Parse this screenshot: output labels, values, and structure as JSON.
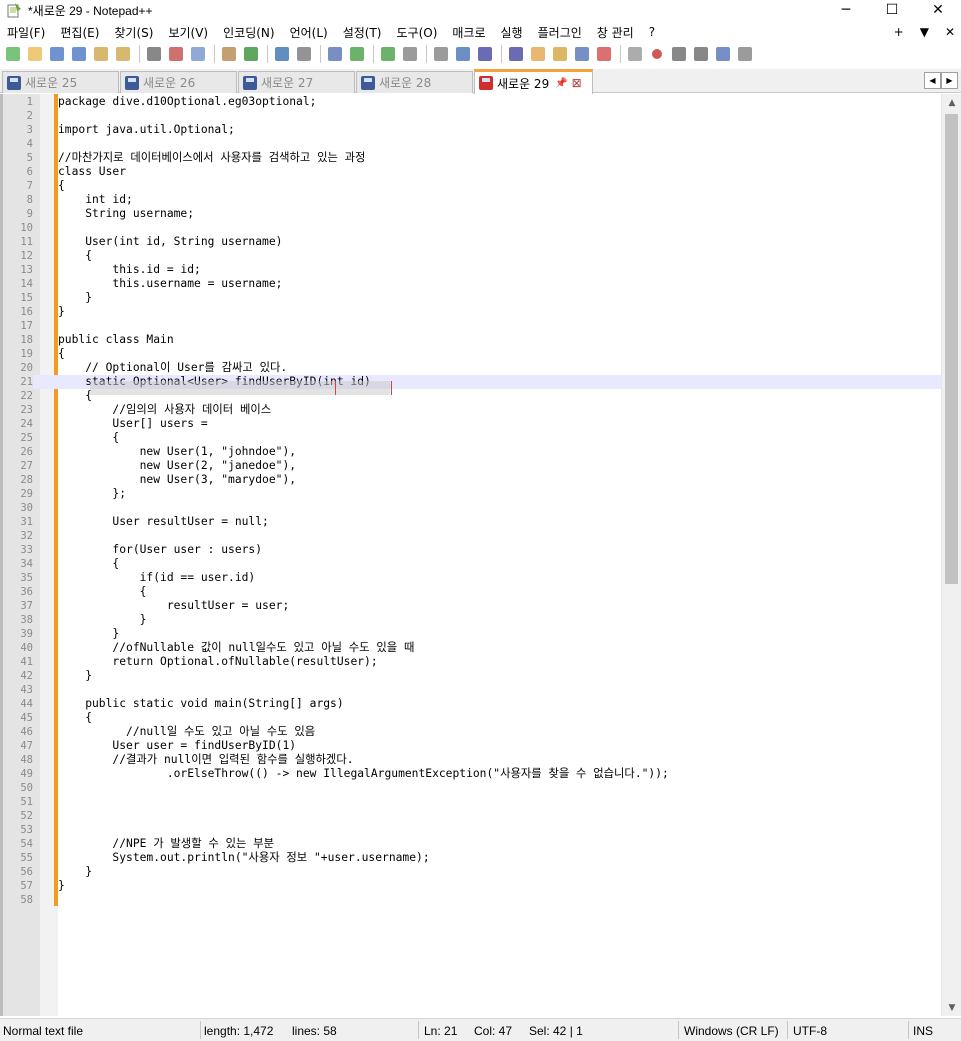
{
  "window": {
    "title": "*새로운 29 - Notepad++",
    "minimize": "─",
    "maximize": "☐",
    "close": "✕"
  },
  "menu": {
    "items": [
      "파일(F)",
      "편집(E)",
      "찾기(S)",
      "보기(V)",
      "인코딩(N)",
      "언어(L)",
      "설정(T)",
      "도구(O)",
      "매크로",
      "실행",
      "플러그인",
      "창 관리",
      "?"
    ],
    "right": [
      "+",
      "▼",
      "✕"
    ]
  },
  "toolbar": {
    "icons": [
      "new-file-icon",
      "open-file-icon",
      "save-icon",
      "save-all-icon",
      "close-icon",
      "close-all-icon",
      "print-icon",
      "cut-icon",
      "copy-icon",
      "paste-icon",
      "undo-icon",
      "redo-icon",
      "find-icon",
      "replace-icon",
      "zoom-in-icon",
      "zoom-out-icon",
      "sync-vertical-icon",
      "sync-horizontal-icon",
      "word-wrap-icon",
      "show-all-chars-icon",
      "indent-guide-icon",
      "udl-icon",
      "doc-map-icon",
      "function-list-icon",
      "folder-workspace-icon",
      "monitoring-icon",
      "record-macro-icon",
      "stop-macro-icon",
      "play-macro-icon",
      "run-macro-multiple-icon",
      "save-macro-icon"
    ]
  },
  "tabs": [
    {
      "label": "새로운 25"
    },
    {
      "label": "새로운 26"
    },
    {
      "label": "새로운 27"
    },
    {
      "label": "새로운 28"
    },
    {
      "label": "새로운 29",
      "pin": "📌",
      "close": "⊠"
    }
  ],
  "tab_nav": {
    "left": "◀",
    "right": "▶"
  },
  "editor": {
    "current_line": 21,
    "lines": [
      "package dive.d10Optional.eg03optional;",
      "",
      "import java.util.Optional;",
      "",
      "//마찬가지로 데이터베이스에서 사용자를 검색하고 있는 과정",
      "class User",
      "{",
      "    int id;",
      "    String username;",
      "",
      "    User(int id, String username)",
      "    {",
      "        this.id = id;",
      "        this.username = username;",
      "    }",
      "}",
      "",
      "public class Main",
      "{",
      "    // Optional이 User를 감싸고 있다.",
      "    static Optional<User> findUserByID(int id)",
      "    {",
      "        //임의의 사용자 데이터 베이스",
      "        User[] users =",
      "        {",
      "            new User(1, \"johndoe\"),",
      "            new User(2, \"janedoe\"),",
      "            new User(3, \"marydoe\"),",
      "        };",
      "",
      "        User resultUser = null;",
      "",
      "        for(User user : users)",
      "        {",
      "            if(id == user.id)",
      "            {",
      "                resultUser = user;",
      "            }",
      "        }",
      "        //ofNullable 값이 null일수도 있고 아닐 수도 있을 때",
      "        return Optional.ofNullable(resultUser);",
      "    }",
      "",
      "    public static void main(String[] args)",
      "    {",
      "          //null일 수도 있고 아닐 수도 있음",
      "        User user = findUserByID(1)",
      "        //결과가 null이면 입력된 함수를 실행하겠다.",
      "                .orElseThrow(() -> new IllegalArgumentException(\"사용자를 찾을 수 없습니다.\"));",
      "",
      "",
      "",
      "",
      "        //NPE 가 발생할 수 있는 부분",
      "        System.out.println(\"사용자 정보 \"+user.username);",
      "    }",
      "}",
      ""
    ]
  },
  "scrollbar": {
    "up": "▲",
    "down": "▼"
  },
  "status": {
    "type": "Normal text file",
    "length": "length: 1,472",
    "lines": "lines: 58",
    "ln": "Ln: 21",
    "col": "Col: 47",
    "sel": "Sel: 42 | 1",
    "eol": "Windows (CR LF)",
    "encoding": "UTF-8",
    "mode": "INS"
  },
  "colors": {
    "accent_tab": "#f6a23c",
    "change_bar": "#f39a24",
    "current_line": "#e8e8ff"
  }
}
